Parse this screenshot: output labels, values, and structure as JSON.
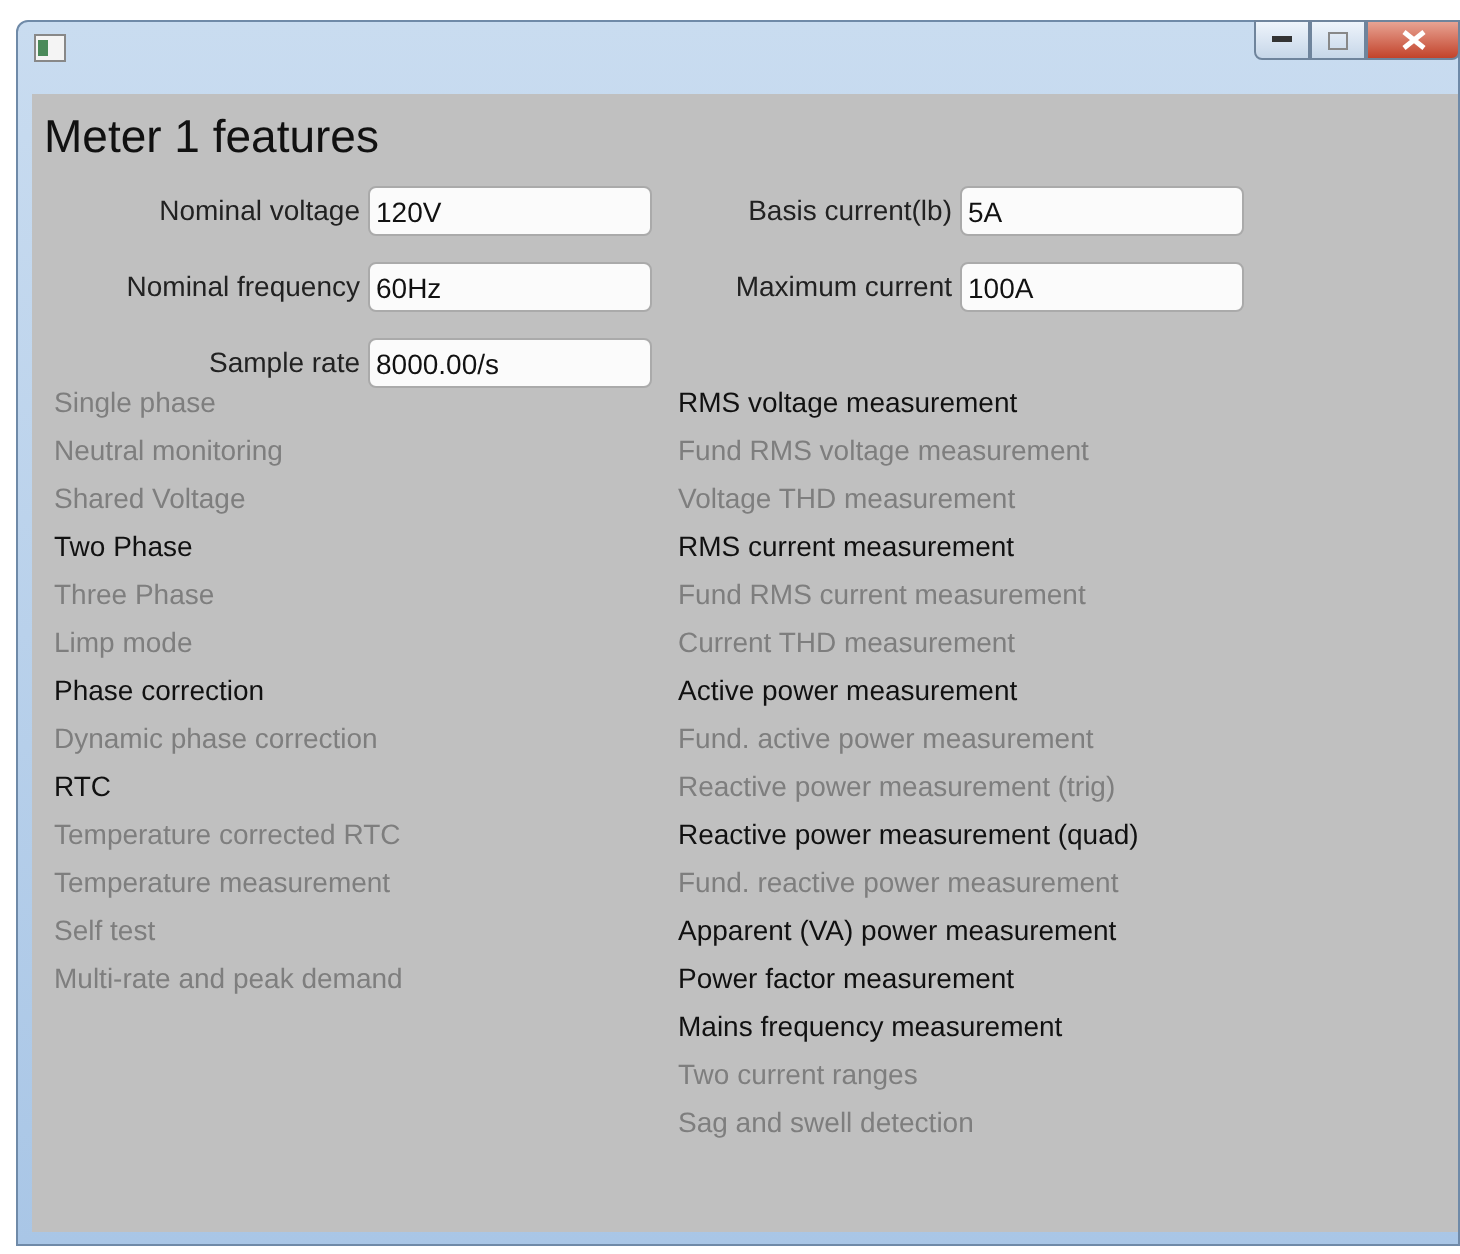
{
  "heading": "Meter 1 features",
  "fields_left": [
    {
      "label": "Nominal voltage",
      "value": "120V"
    },
    {
      "label": "Nominal frequency",
      "value": "60Hz"
    },
    {
      "label": "Sample rate",
      "value": "8000.00/s"
    }
  ],
  "fields_right": [
    {
      "label": "Basis current(lb)",
      "value": "5A"
    },
    {
      "label": "Maximum current",
      "value": "100A"
    }
  ],
  "features_left": [
    {
      "label": "Single phase",
      "enabled": false
    },
    {
      "label": "Neutral monitoring",
      "enabled": false
    },
    {
      "label": "Shared Voltage",
      "enabled": false
    },
    {
      "label": "Two Phase",
      "enabled": true
    },
    {
      "label": "Three Phase",
      "enabled": false
    },
    {
      "label": "Limp mode",
      "enabled": false
    },
    {
      "label": "Phase correction",
      "enabled": true
    },
    {
      "label": "Dynamic phase correction",
      "enabled": false
    },
    {
      "label": "RTC",
      "enabled": true
    },
    {
      "label": "Temperature corrected RTC",
      "enabled": false
    },
    {
      "label": "Temperature measurement",
      "enabled": false
    },
    {
      "label": "Self test",
      "enabled": false
    },
    {
      "label": "Multi-rate and peak demand",
      "enabled": false
    }
  ],
  "features_right": [
    {
      "label": "RMS voltage measurement",
      "enabled": true
    },
    {
      "label": "Fund RMS voltage measurement",
      "enabled": false
    },
    {
      "label": "Voltage THD measurement",
      "enabled": false
    },
    {
      "label": "RMS current measurement",
      "enabled": true
    },
    {
      "label": "Fund RMS current measurement",
      "enabled": false
    },
    {
      "label": "Current THD measurement",
      "enabled": false
    },
    {
      "label": "Active power measurement",
      "enabled": true
    },
    {
      "label": "Fund. active power measurement",
      "enabled": false
    },
    {
      "label": "Reactive power measurement (trig)",
      "enabled": false
    },
    {
      "label": "Reactive power measurement (quad)",
      "enabled": true
    },
    {
      "label": "Fund. reactive power measurement",
      "enabled": false
    },
    {
      "label": "Apparent (VA) power measurement",
      "enabled": true
    },
    {
      "label": "Power factor measurement",
      "enabled": true
    },
    {
      "label": "Mains frequency measurement",
      "enabled": true
    },
    {
      "label": "Two current ranges",
      "enabled": false
    },
    {
      "label": "Sag and swell detection",
      "enabled": false
    }
  ]
}
